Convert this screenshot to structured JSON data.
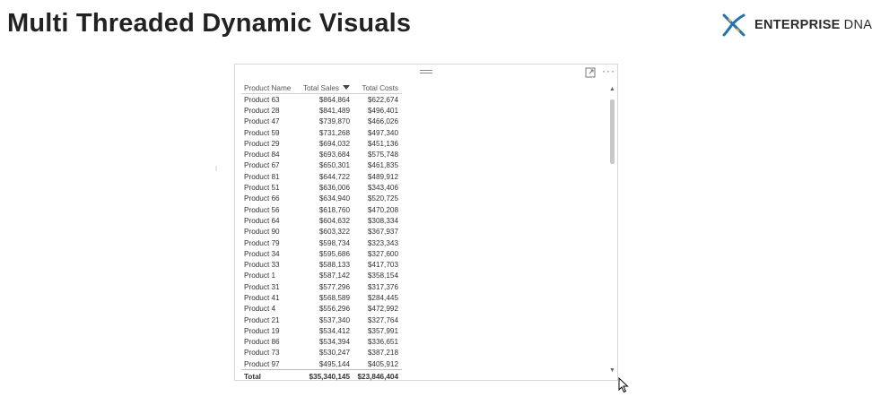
{
  "page": {
    "title": "Multi Threaded Dynamic Visuals"
  },
  "logo": {
    "word1": "ENTERPRISE",
    "word2": "DNA",
    "icon": "dna-helix-icon",
    "colors": {
      "blue": "#1b75bb",
      "orange": "#f5a623"
    }
  },
  "visual": {
    "header_icons": [
      "drag-handle-icon",
      "focus-mode-icon",
      "more-options-icon"
    ],
    "table": {
      "columns": [
        "Product Name",
        "Total Sales",
        "Total Costs"
      ],
      "sort_column": "Total Sales",
      "sort_direction": "descending",
      "rows": [
        [
          "Product 63",
          "$864,864",
          "$622,674"
        ],
        [
          "Product 28",
          "$841,489",
          "$496,401"
        ],
        [
          "Product 47",
          "$739,870",
          "$466,026"
        ],
        [
          "Product 59",
          "$731,268",
          "$497,340"
        ],
        [
          "Product 29",
          "$694,032",
          "$451,136"
        ],
        [
          "Product 84",
          "$693,684",
          "$575,748"
        ],
        [
          "Product 67",
          "$650,301",
          "$461,835"
        ],
        [
          "Product 81",
          "$644,722",
          "$489,912"
        ],
        [
          "Product 51",
          "$636,006",
          "$343,406"
        ],
        [
          "Product 66",
          "$634,940",
          "$520,725"
        ],
        [
          "Product 56",
          "$618,760",
          "$470,208"
        ],
        [
          "Product 64",
          "$604,632",
          "$308,334"
        ],
        [
          "Product 90",
          "$603,322",
          "$367,937"
        ],
        [
          "Product 79",
          "$598,734",
          "$323,343"
        ],
        [
          "Product 34",
          "$595,686",
          "$327,600"
        ],
        [
          "Product 33",
          "$588,133",
          "$417,703"
        ],
        [
          "Product 1",
          "$587,142",
          "$358,154"
        ],
        [
          "Product 31",
          "$577,296",
          "$317,376"
        ],
        [
          "Product 41",
          "$568,589",
          "$284,445"
        ],
        [
          "Product 4",
          "$556,296",
          "$472,992"
        ],
        [
          "Product 21",
          "$537,340",
          "$327,764"
        ],
        [
          "Product 19",
          "$534,412",
          "$357,991"
        ],
        [
          "Product 86",
          "$534,394",
          "$336,651"
        ],
        [
          "Product 73",
          "$530,247",
          "$387,218"
        ],
        [
          "Product 97",
          "$495,144",
          "$405,912"
        ]
      ],
      "total": [
        "Total",
        "$35,340,145",
        "$23,846,404"
      ]
    }
  }
}
